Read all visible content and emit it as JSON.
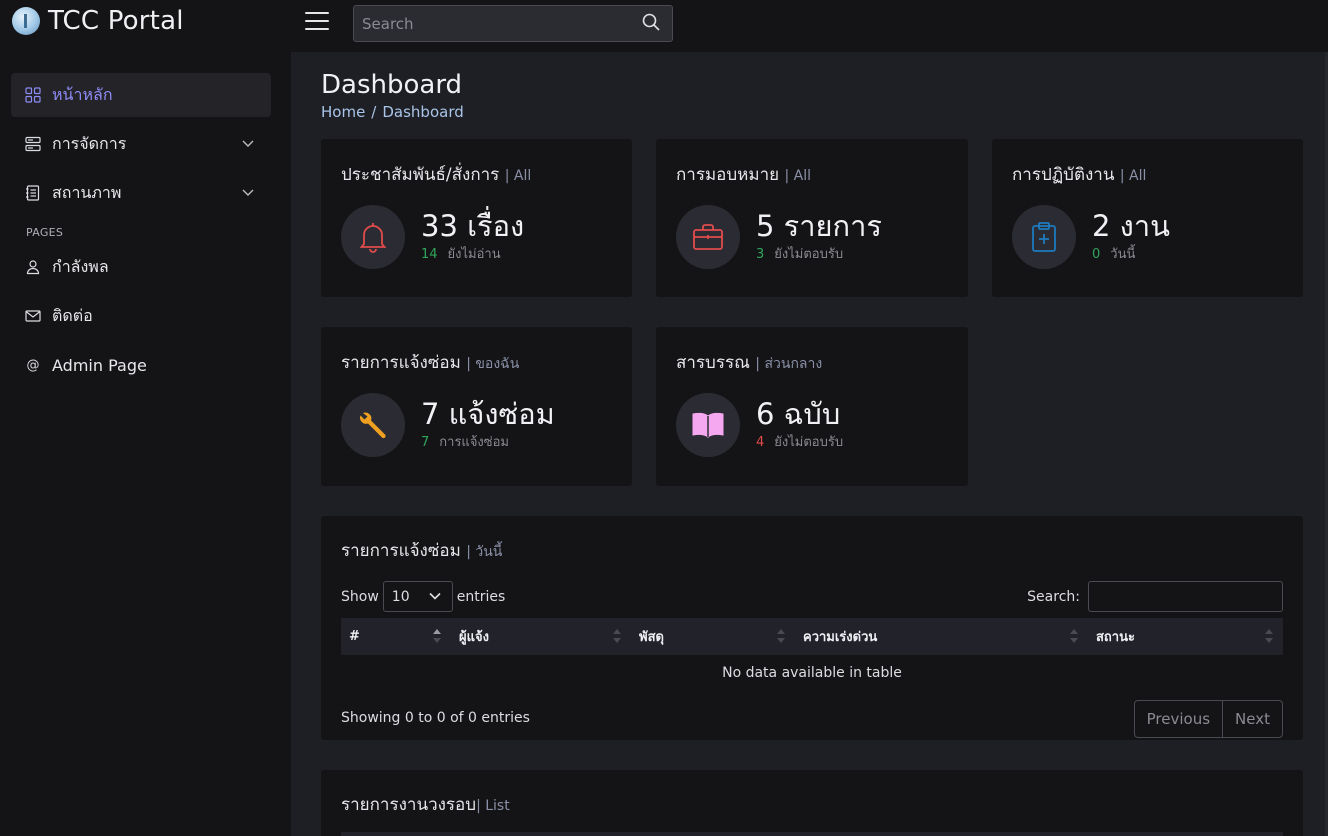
{
  "app": {
    "title": "TCC Portal"
  },
  "header": {
    "search_placeholder": "Search"
  },
  "sidebar": {
    "items": [
      {
        "label": "หน้าหลัก",
        "icon": "grid-icon",
        "active": true
      },
      {
        "label": "การจัดการ",
        "icon": "server-icon",
        "expandable": true
      },
      {
        "label": "สถานภาพ",
        "icon": "journal-icon",
        "expandable": true
      },
      {
        "label": "กำลังพล",
        "icon": "person-icon"
      },
      {
        "label": "ติดต่อ",
        "icon": "envelope-icon"
      },
      {
        "label": "Admin Page",
        "icon": "at-icon"
      }
    ],
    "section_heading": "PAGES"
  },
  "page": {
    "title": "Dashboard",
    "breadcrumb": [
      "Home",
      "Dashboard"
    ]
  },
  "cards": [
    {
      "title": "ประชาสัมพันธ์/สั่งการ",
      "scope": "| All",
      "value": "33 เรื่อง",
      "count": "14",
      "count_label": "ยังไม่อ่าน",
      "count_color": "#2fa65b",
      "icon": "bell-icon",
      "icon_color": "#e04b4b"
    },
    {
      "title": "การมอบหมาย",
      "scope": "| All",
      "value": "5 รายการ",
      "count": "3",
      "count_label": "ยังไม่ตอบรับ",
      "count_color": "#2fa65b",
      "icon": "briefcase-icon",
      "icon_color": "#e04b4b"
    },
    {
      "title": "การปฏิบัติงาน",
      "scope": "| All",
      "value": "2 งาน",
      "count": "0",
      "count_label": "วันนี้",
      "count_color": "#2fa65b",
      "icon": "clipboard-plus-icon",
      "icon_color": "#1d7bbf"
    },
    {
      "title": "รายการแจ้งซ่อม",
      "scope": "| ของฉัน",
      "value": "7 แจ้งซ่อม",
      "count": "7",
      "count_label": "การแจ้งซ่อม",
      "count_color": "#2fa65b",
      "icon": "wrench-icon",
      "icon_color": "#f0a020"
    },
    {
      "title": "สารบรรณ",
      "scope": "| ส่วนกลาง",
      "value": "6 ฉบับ",
      "count": "4",
      "count_label": "ยังไม่ตอบรับ",
      "count_color": "#e04b4b",
      "icon": "book-icon",
      "icon_color": "#f5a8f0"
    }
  ],
  "repair_table": {
    "title": "รายการแจ้งซ่อม",
    "scope": "| วันนี้",
    "show_label": "Show",
    "entries_label": "entries",
    "page_length": "10",
    "search_label": "Search:",
    "columns": [
      "#",
      "ผู้แจ้ง",
      "พัสดุ",
      "ความเร่งด่วน",
      "สถานะ"
    ],
    "empty_message": "No data available in table",
    "info": "Showing 0 to 0 of 0 entries",
    "prev_label": "Previous",
    "next_label": "Next"
  },
  "rounds_card": {
    "title": "รายการงานวงรอบ",
    "scope": "| List"
  }
}
